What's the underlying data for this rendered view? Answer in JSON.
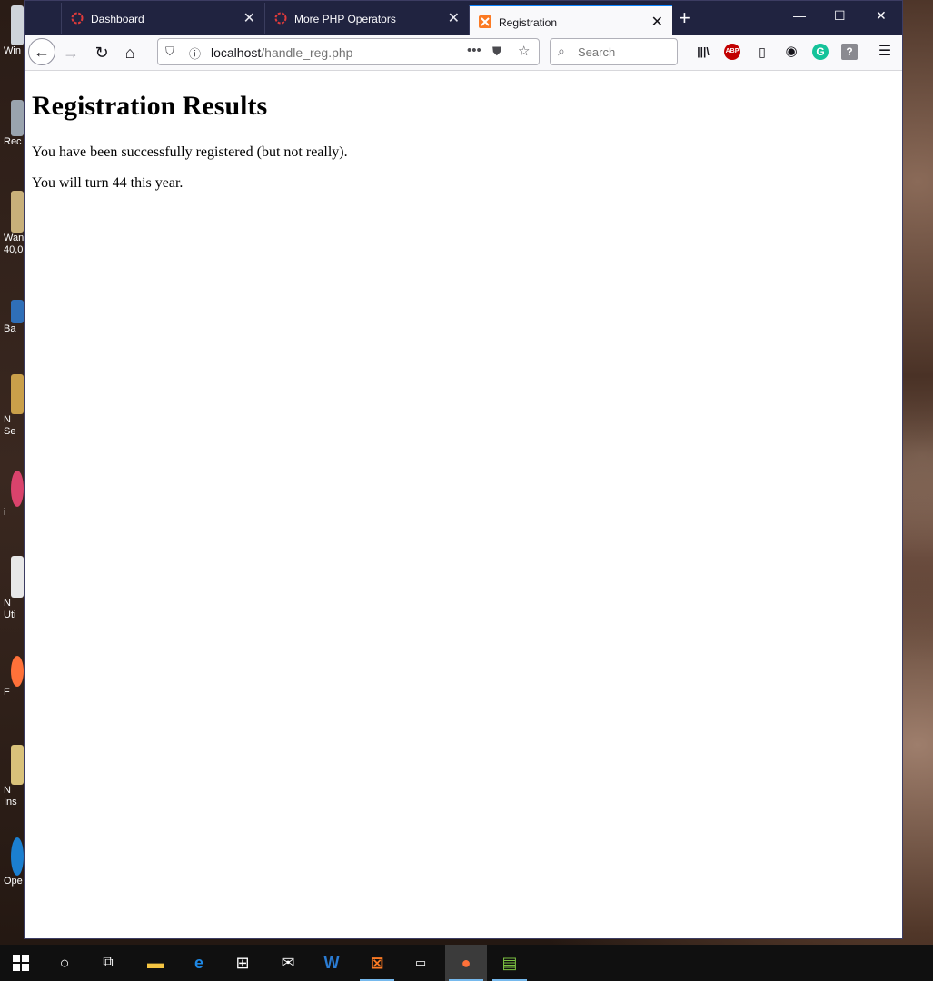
{
  "desktop": {
    "icons": [
      {
        "label": "Win",
        "icon": "windows-icon"
      },
      {
        "label": "Rec",
        "icon": "recycle-bin-icon"
      },
      {
        "label": "Wan 40,0",
        "icon": "shortcut-icon"
      },
      {
        "label": "Ba",
        "icon": "shortcut-icon"
      },
      {
        "label": "N Se",
        "icon": "shortcut-icon"
      },
      {
        "label": "i",
        "icon": "shortcut-icon"
      },
      {
        "label": "N Uti",
        "icon": "shortcut-icon"
      },
      {
        "label": "F",
        "icon": "firefox-icon"
      },
      {
        "label": "N Ins",
        "icon": "shortcut-icon"
      },
      {
        "label": "Ope",
        "icon": "shortcut-icon"
      }
    ]
  },
  "tabs": [
    {
      "label": "Dashboard",
      "icon": "ring-icon",
      "active": false
    },
    {
      "label": "More PHP Operators",
      "icon": "ring-icon",
      "active": false
    },
    {
      "label": "Registration",
      "icon": "xampp-icon",
      "active": true
    }
  ],
  "window_controls": {
    "minimize": "—",
    "maximize": "☐",
    "close": "✕"
  },
  "navbar": {
    "url_host": "localhost",
    "url_path": "/handle_reg.php",
    "search_placeholder": "Search"
  },
  "page": {
    "heading": "Registration Results",
    "line1": "You have been successfully registered (but not really).",
    "line2": "You will turn 44 this year."
  },
  "colors": {
    "tabbar": "#202340",
    "active_tab_accent": "#0a84ff",
    "taskbar": "#101010"
  }
}
